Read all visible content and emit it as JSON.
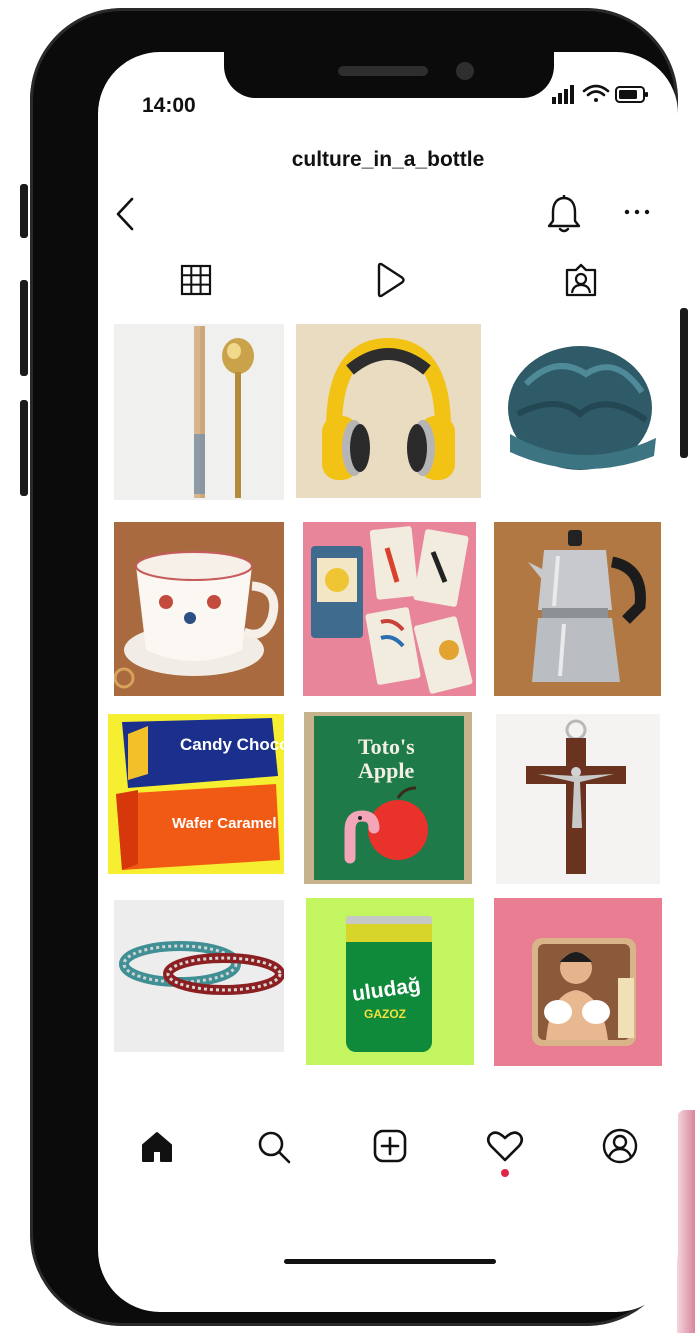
{
  "status_bar": {
    "time": "14:00"
  },
  "profile": {
    "username": "culture_in_a_bottle"
  },
  "header": {
    "back_icon": "chevron-left-icon",
    "notification_icon": "bell-icon",
    "more_icon": "more-horizontal-icon"
  },
  "tabs": [
    {
      "icon": "grid-icon"
    },
    {
      "icon": "reels-play-icon"
    },
    {
      "icon": "tagged-person-icon"
    }
  ],
  "posts": [
    {
      "subject": "chopsticks-and-spoon"
    },
    {
      "subject": "yellow-headphones"
    },
    {
      "subject": "satin-bonnet"
    },
    {
      "subject": "teacup"
    },
    {
      "subject": "playing-cards"
    },
    {
      "subject": "moka-pot"
    },
    {
      "subject": "candy-wrappers",
      "text_top": "Candy Choco",
      "text_bottom": "Wafer Caramel"
    },
    {
      "subject": "book",
      "title_line1": "Toto's",
      "title_line2": "Apple"
    },
    {
      "subject": "crucifix"
    },
    {
      "subject": "bracelets"
    },
    {
      "subject": "soda-can",
      "brand": "uludağ",
      "sub": "GAZOZ"
    },
    {
      "subject": "magnet-portrait"
    }
  ],
  "bottom_nav": [
    {
      "icon": "home-icon",
      "active": true
    },
    {
      "icon": "search-icon"
    },
    {
      "icon": "add-post-icon"
    },
    {
      "icon": "heart-icon",
      "notification_dot": true
    },
    {
      "icon": "profile-icon"
    }
  ],
  "colors": {
    "text": "#111111",
    "notification_dot": "#e0244a",
    "pink_background": "#e97d92"
  }
}
